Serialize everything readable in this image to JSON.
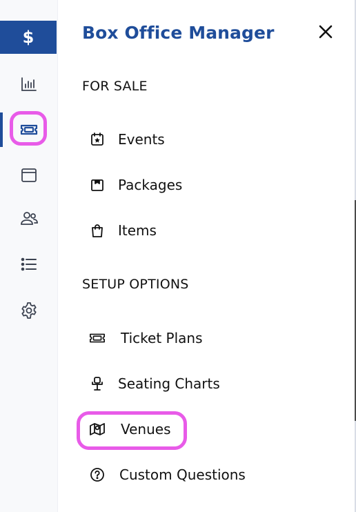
{
  "app": {
    "brand_symbol": "$",
    "title": "Box Office Manager",
    "accent": "#1f4d9a",
    "highlight": "#e85be8"
  },
  "rail": {
    "items": [
      {
        "icon": "bar-chart-icon"
      },
      {
        "icon": "ticket-icon",
        "active": true
      },
      {
        "icon": "browser-window-icon"
      },
      {
        "icon": "users-icon"
      },
      {
        "icon": "list-icon"
      },
      {
        "icon": "gear-icon"
      }
    ]
  },
  "sections": {
    "for_sale": {
      "label": "FOR SALE",
      "items": [
        {
          "label": "Events",
          "icon": "calendar-star-icon"
        },
        {
          "label": "Packages",
          "icon": "package-icon"
        },
        {
          "label": "Items",
          "icon": "shopping-bag-icon"
        }
      ]
    },
    "setup": {
      "label": "SETUP OPTIONS",
      "items": [
        {
          "label": "Ticket Plans",
          "icon": "ticket-icon"
        },
        {
          "label": "Seating Charts",
          "icon": "chair-icon"
        },
        {
          "label": "Venues",
          "icon": "map-icon",
          "highlighted": true
        },
        {
          "label": "Custom Questions",
          "icon": "question-circle-icon"
        }
      ]
    }
  }
}
